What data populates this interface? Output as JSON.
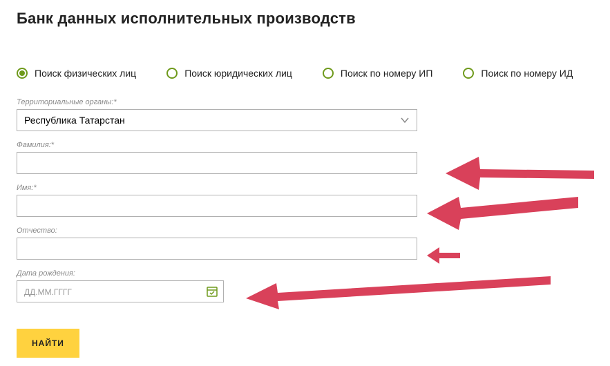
{
  "title": "Банк данных исполнительных производств",
  "radios": {
    "individual": "Поиск физических лиц",
    "legal": "Поиск юридических лиц",
    "byIp": "Поиск по номеру ИП",
    "byId": "Поиск по номеру ИД"
  },
  "form": {
    "territory": {
      "label": "Территориальные органы:*",
      "value": "Республика Татарстан"
    },
    "surname": {
      "label": "Фамилия:*",
      "value": ""
    },
    "name": {
      "label": "Имя:*",
      "value": ""
    },
    "patronymic": {
      "label": "Отчество:",
      "value": ""
    },
    "dob": {
      "label": "Дата рождения:",
      "placeholder": "ДД.ММ.ГГГГ",
      "value": ""
    }
  },
  "submit": "НАЙТИ",
  "colors": {
    "accent": "#6f9a1c",
    "button": "#ffd23f",
    "arrow": "#d9415a"
  }
}
